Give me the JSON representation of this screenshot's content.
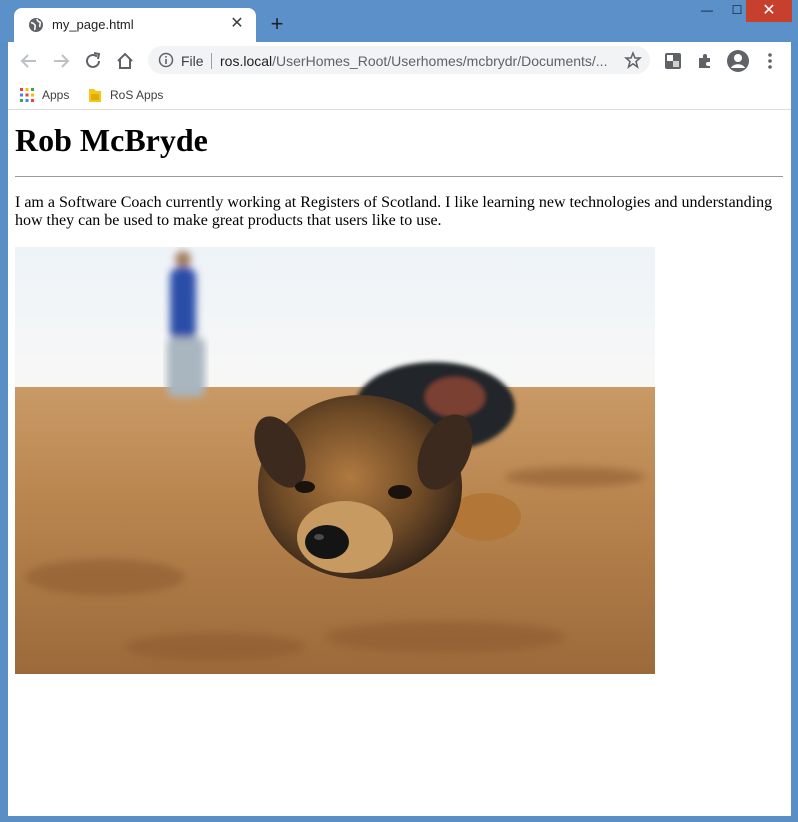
{
  "tab": {
    "title": "my_page.html",
    "close_glyph": "✕"
  },
  "new_tab_glyph": "+",
  "window_controls": {
    "minimize": "—",
    "maximize": "☐",
    "close": "✕"
  },
  "omnibox": {
    "scheme": "File",
    "host": "ros.local",
    "path": "/UserHomes_Root/Userhomes/mcbrydr/Documents/..."
  },
  "bookmarks": [
    {
      "label": "Apps",
      "icon": "apps-grid-icon"
    },
    {
      "label": "RoS Apps",
      "icon": "folder-icon"
    }
  ],
  "page": {
    "heading": "Rob McBryde",
    "intro": "I am a Software Coach currently working at Registers of Scotland. I like learning new technologies and understanding how they can be used to make great products that users like to use.",
    "image_subject": "puppy lying on sandy beach"
  },
  "colors": {
    "title_bar": "#5b90c8",
    "close_button": "#c7402d"
  }
}
